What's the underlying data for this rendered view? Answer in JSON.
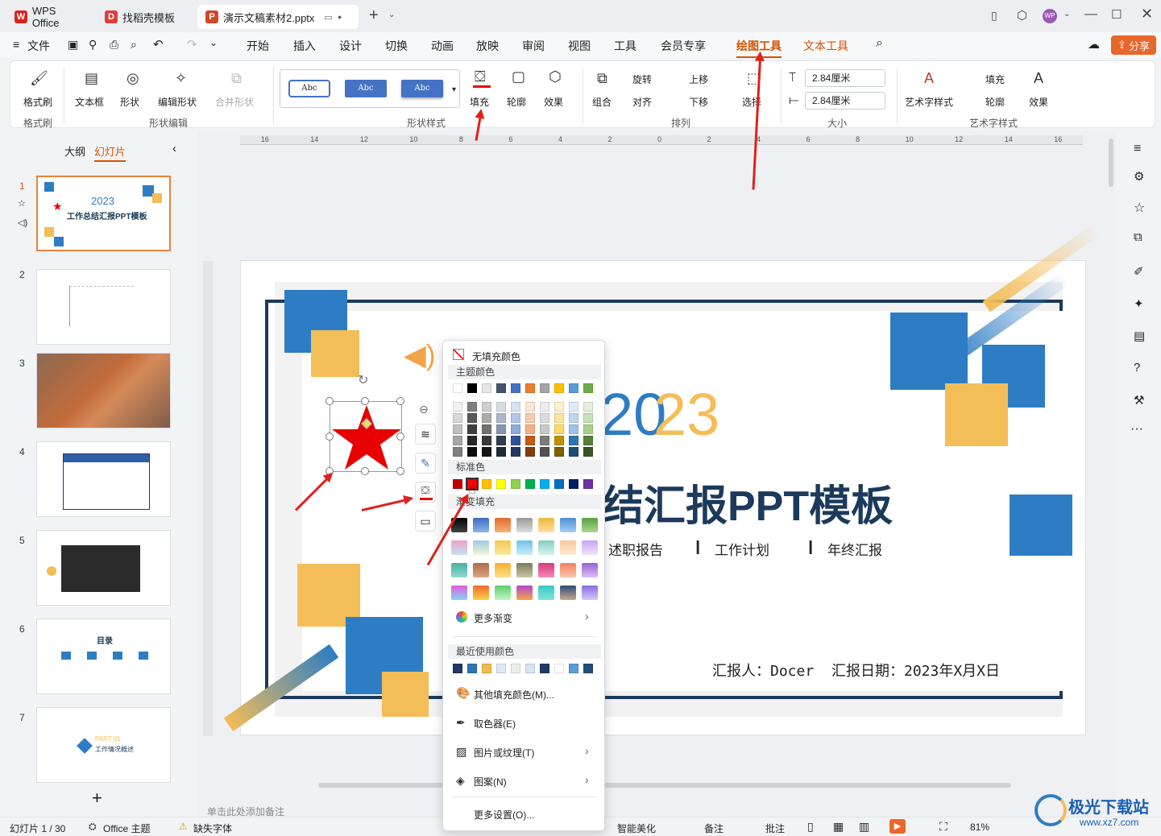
{
  "titlebar": {
    "tabs": [
      {
        "label": "WPS Office",
        "logo": "W"
      },
      {
        "label": "找稻壳模板",
        "logo": "D"
      },
      {
        "label": "演示文稿素材2.pptx",
        "logo": "P"
      }
    ],
    "avatar": "WP"
  },
  "menubar": {
    "file": "文件",
    "items": [
      "开始",
      "插入",
      "设计",
      "切换",
      "动画",
      "放映",
      "审阅",
      "视图",
      "工具",
      "会员专享"
    ],
    "active": "绘图工具",
    "text_tools": "文本工具",
    "share": "分享"
  },
  "ribbon": {
    "format_painter": "格式刷",
    "textbox": "文本框",
    "shape": "形状",
    "edit_shape": "编辑形状",
    "merge_shape": "合并形状",
    "style_samples": [
      "Abc",
      "Abc",
      "Abc"
    ],
    "fill": "填充",
    "outline": "轮廓",
    "effect": "效果",
    "group": "组合",
    "rotate": "旋转",
    "align": "对齐",
    "bring_forward": "上移",
    "send_backward": "下移",
    "select": "选择",
    "height": "2.84厘米",
    "width": "2.84厘米",
    "art_style": "艺术字样式",
    "text_fill": "填充",
    "text_outline": "轮廓",
    "text_effect": "效果",
    "groups": {
      "format_painter": "格式刷",
      "shape_edit": "形状编辑",
      "shape_style": "形状样式",
      "arrange": "排列",
      "size": "大小",
      "art_text": "艺术字样式"
    }
  },
  "panel": {
    "outline_tab": "大纲",
    "slides_tab": "幻灯片",
    "slide_numbers": [
      "1",
      "2",
      "3",
      "4",
      "5",
      "6",
      "7"
    ],
    "add": "+"
  },
  "thumbs": {
    "t1_year": "2023",
    "t1_title": "工作总结汇报PPT模板",
    "t6_title": "目录",
    "t7_part": "PART 01",
    "t7_title": "工作情况概述"
  },
  "ruler_labels": [
    "16",
    "14",
    "12",
    "10",
    "8",
    "6",
    "4",
    "2",
    "0",
    "2",
    "4",
    "6",
    "8",
    "10",
    "12",
    "14",
    "16"
  ],
  "slide": {
    "year_a": "20",
    "year_b": "23",
    "title": "结汇报PPT模板",
    "subtitle_items": [
      "述职报告",
      "工作计划",
      "年终汇报"
    ],
    "reporter": "汇报人：Docer",
    "date": "汇报日期：2023年X月X日"
  },
  "notes_placeholder": "单击此处添加备注",
  "popup": {
    "no_fill": "无填充颜色",
    "theme_colors": "主题颜色",
    "standard_colors": "标准色",
    "gradient_fill": "渐变填充",
    "more_gradient": "更多渐变",
    "recent_colors": "最近使用颜色",
    "more_fill": "其他填充颜色(M)...",
    "eyedropper": "取色器(E)",
    "picture_texture": "图片或纹理(T)",
    "pattern": "图案(N)",
    "more_settings": "更多设置(O)...",
    "theme_top": [
      "#ffffff",
      "#000000",
      "#e7e6e6",
      "#44546a",
      "#4472c4",
      "#ed7d31",
      "#a5a5a5",
      "#ffc000",
      "#5b9bd5",
      "#70ad47"
    ],
    "theme_shades": [
      [
        "#f2f2f2",
        "#7f7f7f",
        "#d0cece",
        "#d6dce4",
        "#d9e2f3",
        "#fbe5d5",
        "#ededed",
        "#fff2cc",
        "#deebf6",
        "#e2efd9"
      ],
      [
        "#d8d8d8",
        "#595959",
        "#aeabab",
        "#adb9ca",
        "#b4c6e7",
        "#f7cbac",
        "#dbdbdb",
        "#fee599",
        "#bdd7ee",
        "#c5e0b3"
      ],
      [
        "#bfbfbf",
        "#3f3f3f",
        "#757070",
        "#8496b0",
        "#8eaadb",
        "#f4b183",
        "#c9c9c9",
        "#ffd965",
        "#9cc3e5",
        "#a8d08d"
      ],
      [
        "#a5a5a5",
        "#262626",
        "#3a3838",
        "#323f4f",
        "#2f5496",
        "#c55a11",
        "#7b7b7b",
        "#bf9000",
        "#2e75b5",
        "#538135"
      ],
      [
        "#7f7f7f",
        "#0c0c0c",
        "#171616",
        "#222a35",
        "#1f3864",
        "#833c0b",
        "#525252",
        "#7f6000",
        "#1e4e79",
        "#375623"
      ]
    ],
    "standard": [
      "#c00000",
      "#ff0000",
      "#ffc000",
      "#ffff00",
      "#92d050",
      "#00b050",
      "#00b0f0",
      "#0070c0",
      "#002060",
      "#7030a0"
    ],
    "recent": [
      "#1f3864",
      "#2e75b5",
      "#f2b94d",
      "#deebf6",
      "#ededed",
      "#d9e2f3",
      "#1f3864",
      "#ffffff",
      "#5b9bd5",
      "#1f4e79"
    ]
  },
  "status": {
    "slide_info": "幻灯片 1 / 30",
    "theme": "Office 主题",
    "missing_font": "缺失字体",
    "beautify": "智能美化",
    "notes": "备注",
    "comments": "批注",
    "zoom": "81%"
  },
  "watermark": {
    "site": "极光下载站",
    "url": "www.xz7.com"
  },
  "colors": {
    "accent": "#d35400",
    "brand_red": "#c9302c",
    "slide_blue": "#2e7dc4",
    "slide_yellow": "#f3bd58",
    "dark_navy": "#1b3a5c"
  }
}
